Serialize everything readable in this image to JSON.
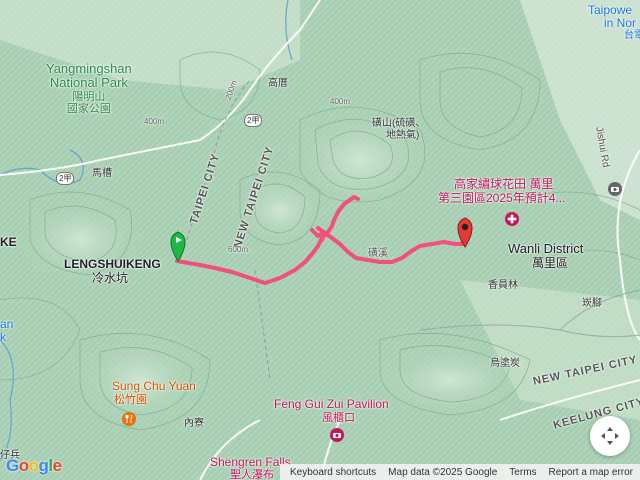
{
  "park": {
    "en_line1": "Yangmingshan",
    "en_line2": "National Park",
    "zh1": "陽明山",
    "zh2": "國家公園"
  },
  "cities": {
    "taipei": "TAIPEI CITY",
    "new_taipei": "NEW TAIPEI CITY",
    "new_taipei_se": "NEW TAIPEI CITY",
    "keelung": "KEELUNG CITY"
  },
  "places": {
    "lengshuikeng_en": "LENGSHUIKENG",
    "lengshuikeng_zh": "冷水坑",
    "wanli_en": "Wanli District",
    "wanli_zh": "萬里區",
    "gaoluo": "高厝",
    "macao": "馬槽",
    "huangshan_l1": "磺山(硫磺、",
    "huangshan_l2": "地熱氣)",
    "xiangyuanlin": "香員林",
    "tanjiao": "崁腳",
    "wutu": "烏塗炭",
    "neiliao": "內寮",
    "zixiao": "仔兵",
    "trail_label": "磺溪",
    "alt_top": "400m",
    "alt_mid": "200m",
    "alt_left": "400m",
    "alt_600": "600m"
  },
  "pois": {
    "flower_l1": "高家繡球花田 萬里",
    "flower_l2": "第三園區2025年預計4...",
    "sungchu_en": "Sung Chu Yuan",
    "sungchu_zh": "松竹園",
    "fenggui_en": "Feng Gui Zui Pavilion",
    "fenggui_zh": "風櫃口",
    "shengren_en": "Shengren Falls",
    "shengren_zh": "聖人瀑布",
    "taipower_l1": "Taipowe",
    "taipower_l2": "in Nor",
    "taipower_l3": "台電",
    "left_edge_1": "KE",
    "left_edge_2": "an",
    "left_edge_3": "k"
  },
  "roads": {
    "shield_2jia_a": "2甲",
    "shield_2": "2甲",
    "shield_2jia_b": "2甲",
    "lishui": "Jishui Rd"
  },
  "footer": {
    "keyboard": "Keyboard shortcuts",
    "mapdata": "Map data ©2025 Google",
    "terms": "Terms",
    "report": "Report a map error"
  },
  "logo": {
    "g": "G",
    "o1": "o",
    "o2": "o",
    "g2": "g",
    "l": "l",
    "e": "e"
  },
  "colors": {
    "route": "#f0507a",
    "start_marker": "#1fb846",
    "end_marker": "#e53935",
    "terrain": "#a9cfb4",
    "poi_pink": "#c2185b",
    "poi_orange": "#e8710a"
  },
  "icons": {
    "fullscreen": "fullscreen-icon",
    "flower_poi": "flower-poi-icon",
    "restaurant_poi": "restaurant-poi-icon",
    "camera_poi": "camera-poi-icon",
    "start": "start-flag-icon",
    "end": "end-pin-icon"
  }
}
